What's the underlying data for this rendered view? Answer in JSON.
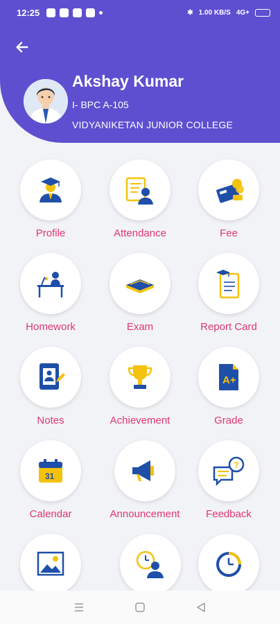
{
  "status": {
    "time": "12:25",
    "net": "1.00 KB/S",
    "signal": "4G+"
  },
  "header": {
    "name": "Akshay Kumar",
    "class_section": "I- BPC A-105",
    "college": "VIDYANIKETAN JUNIOR COLLEGE"
  },
  "menu": [
    {
      "label": "Profile",
      "icon": "graduate-icon"
    },
    {
      "label": "Attendance",
      "icon": "attendance-icon"
    },
    {
      "label": "Fee",
      "icon": "fee-calculator-icon"
    },
    {
      "label": "Homework",
      "icon": "homework-desk-icon"
    },
    {
      "label": "Exam",
      "icon": "exam-book-icon"
    },
    {
      "label": "Report Card",
      "icon": "report-card-icon"
    },
    {
      "label": "Notes",
      "icon": "notes-icon"
    },
    {
      "label": "Achievement",
      "icon": "trophy-icon"
    },
    {
      "label": "Grade",
      "icon": "grade-icon"
    },
    {
      "label": "Calendar",
      "icon": "calendar-icon"
    },
    {
      "label": "Announcement",
      "icon": "megaphone-icon"
    },
    {
      "label": "Feedback",
      "icon": "feedback-icon"
    },
    {
      "label": "",
      "icon": "gallery-icon"
    },
    {
      "label": "",
      "icon": "timetable-icon"
    },
    {
      "label": "",
      "icon": "clock-icon"
    }
  ],
  "calendar_day": "31",
  "grade_text": "A+",
  "colors": {
    "primary": "#5e4fd0",
    "label": "#e0366f",
    "icon_blue": "#1f4fa8",
    "icon_yellow": "#f4c20d"
  }
}
